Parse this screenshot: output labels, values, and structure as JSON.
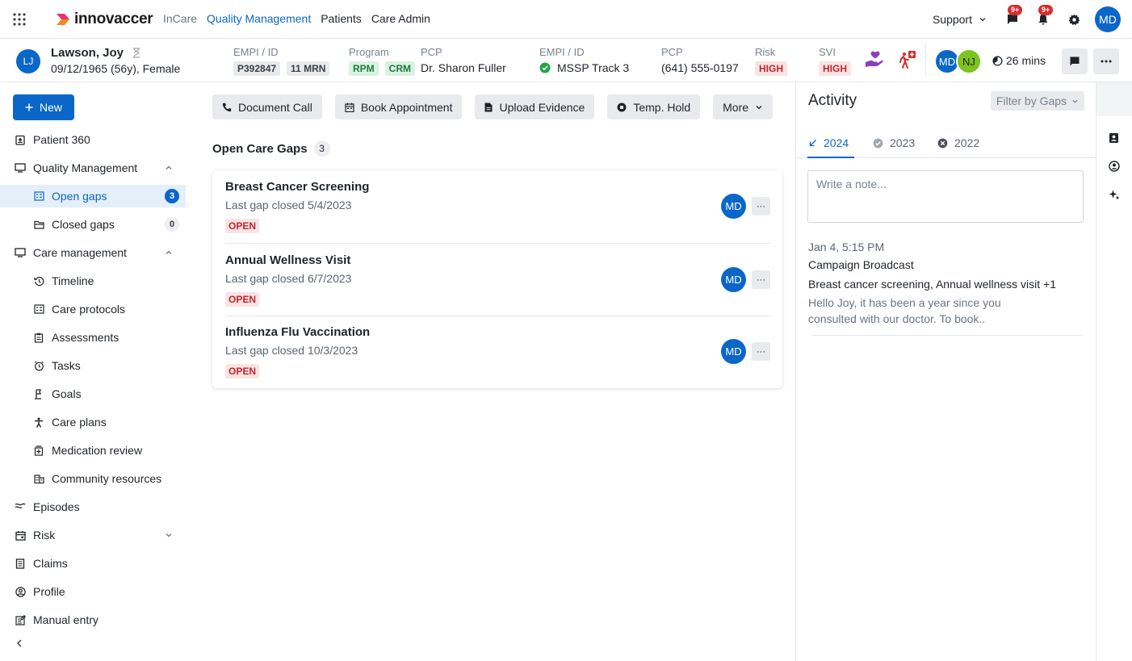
{
  "nav": {
    "brand": "innovaccer",
    "links": [
      "InCare",
      "Quality Management",
      "Patients",
      "Care Admin"
    ],
    "support": "Support",
    "messages_badge": "9+",
    "notifications_badge": "9+",
    "user_initials": "MD"
  },
  "patient": {
    "initials": "LJ",
    "name": "Lawson, Joy",
    "dob": "09/12/1965 (56y), Female",
    "empi_label": "EMPI / ID",
    "empi_id": "P392847",
    "mrn": "11 MRN",
    "program_label": "Program",
    "programs": [
      "RPM",
      "CRM"
    ],
    "pcp_label": "PCP",
    "pcp": "Dr. Sharon Fuller",
    "empi2_label": "EMPI / ID",
    "track": "MSSP Track 3",
    "pcp2_label": "PCP",
    "phone": "(641) 555-0197",
    "risk_label": "Risk",
    "risk": "HIGH",
    "svi_label": "SVI",
    "svi": "HIGH",
    "assignees": [
      "MD",
      "NJ"
    ],
    "timer": "26 mins"
  },
  "sidebar": {
    "new_label": "New",
    "items": [
      {
        "label": "Patient 360"
      },
      {
        "label": "Quality Management"
      },
      {
        "label": "Open gaps",
        "count": "3"
      },
      {
        "label": "Closed gaps",
        "count": "0"
      },
      {
        "label": "Care management"
      },
      {
        "label": "Timeline"
      },
      {
        "label": "Care protocols"
      },
      {
        "label": "Assessments"
      },
      {
        "label": "Tasks"
      },
      {
        "label": "Goals"
      },
      {
        "label": "Care plans"
      },
      {
        "label": "Medication review"
      },
      {
        "label": "Community resources"
      },
      {
        "label": "Episodes"
      },
      {
        "label": "Risk"
      },
      {
        "label": "Claims"
      },
      {
        "label": "Profile"
      },
      {
        "label": "Manual entry"
      }
    ]
  },
  "actions": [
    "Document Call",
    "Book Appointment",
    "Upload Evidence",
    "Temp. Hold",
    "More"
  ],
  "gaps": {
    "title": "Open Care Gaps",
    "count": "3",
    "items": [
      {
        "title": "Breast Cancer Screening",
        "sub": "Last gap closed 5/4/2023",
        "status": "OPEN",
        "assignee": "MD",
        "more": "···"
      },
      {
        "title": "Annual Wellness Visit",
        "sub": "Last gap closed 6/7/2023",
        "status": "OPEN",
        "assignee": "MD",
        "more": "···"
      },
      {
        "title": "Influenza Flu Vaccination",
        "sub": "Last gap closed 10/3/2023",
        "status": "OPEN",
        "assignee": "MD",
        "more": "···"
      }
    ]
  },
  "activity": {
    "title": "Activity",
    "filter": "Filter by Gaps",
    "years": [
      "2024",
      "2023",
      "2022"
    ],
    "note_placeholder": "Write a note...",
    "entry": {
      "time": "Jan 4, 5:15 PM",
      "heading": "Campaign Broadcast",
      "gaps": "Breast cancer screening, Annual wellness visit +1",
      "message": "Hello Joy, it has been a year since you consulted with our doctor. To book.."
    }
  },
  "colors": {
    "accent": "#0a67c9",
    "danger": "#d92c2c",
    "success": "#1e7a3c",
    "nj_avatar": "#7cc31f",
    "care_hands": "#8a3fbf"
  }
}
